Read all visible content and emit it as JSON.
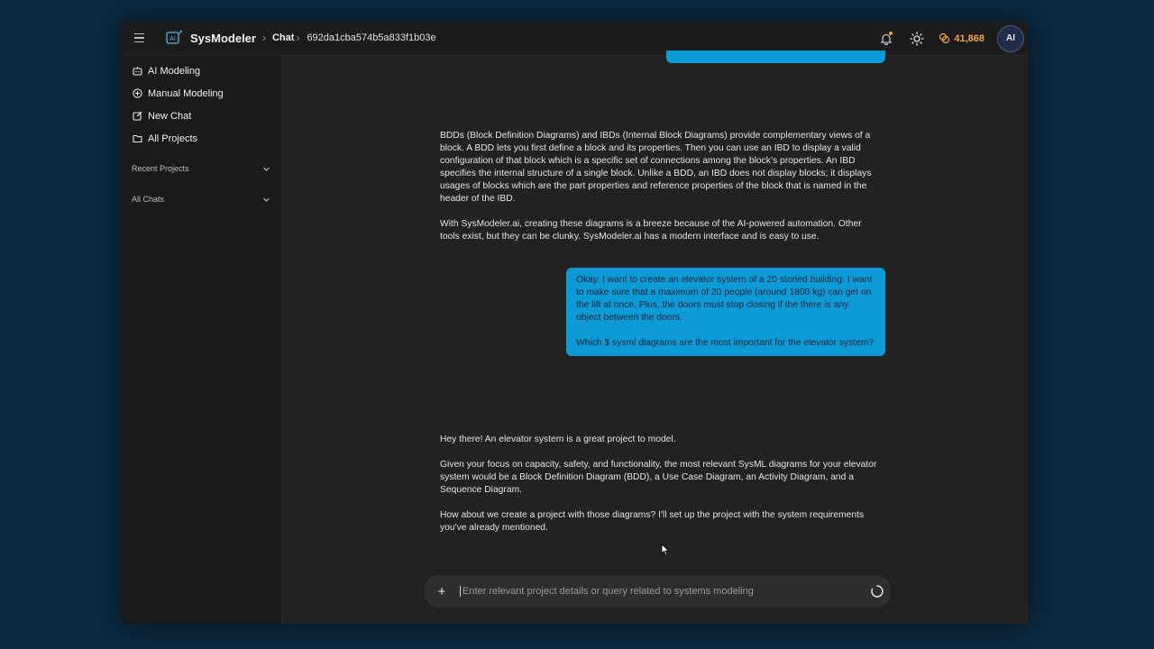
{
  "topbar": {
    "app_name": "SysModeler",
    "crumb_chat": "Chat",
    "chat_id": "692da1cba574b5a833f1b03e",
    "credits": "41,868",
    "avatar_initials": "AI"
  },
  "sidebar": {
    "items": [
      {
        "label": "AI Modeling",
        "icon": "robot-icon"
      },
      {
        "label": "Manual Modeling",
        "icon": "plus-circle-icon"
      },
      {
        "label": "New Chat",
        "icon": "edit-icon"
      },
      {
        "label": "All Projects",
        "icon": "folder-icon"
      }
    ],
    "recent_projects": "Recent Projects",
    "all_chats": "All Chats"
  },
  "messages": {
    "ai1_p1": "BDDs (Block Definition Diagrams) and IBDs (Internal Block Diagrams) provide complementary views of a block. A BDD lets you first define a block and its properties. Then you can use an IBD to display a valid configuration of that block which is a specific set of connections among the block’s properties. An IBD specifies the internal structure of a single block. Unlike a BDD, an IBD does not display blocks; it displays usages of blocks which are the part properties and reference properties of the block that is named in the header of the IBD.",
    "ai1_p2": "With SysModeler.ai, creating these diagrams is a breeze because of the AI-powered automation. Other tools exist, but they can be clunky. SysModeler.ai has a modern interface and is easy to use.",
    "user_p1": "Okay. I want to create an elevator system of a 20 storied building. I want to make sure that a maximum of 20 people (around 1800 kg) can get on the lift at once. Plus, the doors must stop closing if the there is any object between the doors.",
    "user_p2": "Which $ sysml diagrams are the most important for the elevator system?",
    "ai2_p1": "Hey there! An elevator system is a great project to model.",
    "ai2_p2": "Given your focus on capacity, safety, and functionality, the most relevant SysML diagrams for your elevator system would be a Block Definition Diagram (BDD), a Use Case Diagram, an Activity Diagram, and a Sequence Diagram.",
    "ai2_p3": "How about we create a project with those diagrams? I'll set up the project with the system requirements you've already mentioned."
  },
  "composer": {
    "placeholder": "Enter relevant project details or query related to systems modeling",
    "value": ""
  },
  "colors": {
    "accent": "#0d9bd8",
    "credits": "#f0a640",
    "background": "#0c2a42"
  }
}
